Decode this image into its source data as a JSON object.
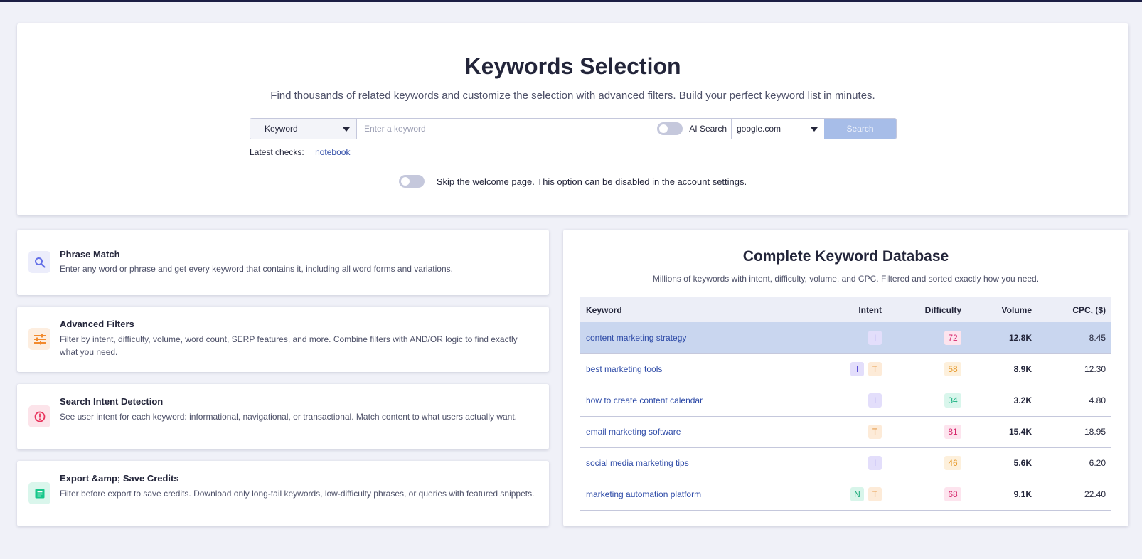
{
  "hero": {
    "title": "Keywords Selection",
    "subtitle": "Find thousands of related keywords and customize the selection with advanced filters. Build your perfect keyword list in minutes.",
    "search": {
      "mode_value": "Keyword",
      "placeholder": "Enter a keyword",
      "ai_label": "AI Search",
      "engine_value": "google.com",
      "button_label": "Search"
    },
    "latest_label": "Latest checks:",
    "latest_link": "notebook",
    "skip_text": "Skip the welcome page. This option can be disabled in the account settings."
  },
  "features": [
    {
      "title": "Phrase Match",
      "text": "Enter any word or phrase and get every keyword that contains it, including all word forms and variations.",
      "icon": "search-icon",
      "color": "#6470e8",
      "bg": "#ecedfb"
    },
    {
      "title": "Advanced Filters",
      "text": "Filter by intent, difficulty, volume, word count, SERP features, and more. Combine filters with AND/OR logic to find exactly what you need.",
      "icon": "sliders-icon",
      "color": "#f28a2e",
      "bg": "#fdeee0"
    },
    {
      "title": "Search Intent Detection",
      "text": "See user intent for each keyword: informational, navigational, or transactional. Match content to what users actually want.",
      "icon": "alert-circle-icon",
      "color": "#e8335c",
      "bg": "#fce4ea"
    },
    {
      "title": "Export &amp; Save Credits",
      "text": "Filter before export to save credits. Download only long-tail keywords, low-difficulty phrases, or queries with featured snippets.",
      "icon": "document-icon",
      "color": "#16c78a",
      "bg": "#daf6ec"
    }
  ],
  "database": {
    "title": "Complete Keyword Database",
    "subtitle": "Millions of keywords with intent, difficulty, volume, and CPC. Filtered and sorted exactly how you need.",
    "columns": [
      "Keyword",
      "Intent",
      "Difficulty",
      "Volume",
      "CPC, ($)"
    ],
    "rows": [
      {
        "keyword": "content marketing strategy",
        "intent": [
          "I"
        ],
        "difficulty": "72",
        "volume": "12.8K",
        "cpc": "8.45"
      },
      {
        "keyword": "best marketing tools",
        "intent": [
          "I",
          "T"
        ],
        "difficulty": "58",
        "volume": "8.9K",
        "cpc": "12.30"
      },
      {
        "keyword": "how to create content calendar",
        "intent": [
          "I"
        ],
        "difficulty": "34",
        "volume": "3.2K",
        "cpc": "4.80"
      },
      {
        "keyword": "email marketing software",
        "intent": [
          "T"
        ],
        "difficulty": "81",
        "volume": "15.4K",
        "cpc": "18.95"
      },
      {
        "keyword": "social media marketing tips",
        "intent": [
          "I"
        ],
        "difficulty": "46",
        "volume": "5.6K",
        "cpc": "6.20"
      },
      {
        "keyword": "marketing automation platform",
        "intent": [
          "N",
          "T"
        ],
        "difficulty": "68",
        "volume": "9.1K",
        "cpc": "22.40"
      }
    ]
  },
  "colors": {
    "intent": {
      "I": {
        "fg": "#5b4fd6",
        "bg": "#e3defb"
      },
      "T": {
        "fg": "#e08a2c",
        "bg": "#fdebd8"
      },
      "N": {
        "fg": "#17a878",
        "bg": "#d8f5ea"
      }
    },
    "difficulty_high": {
      "fg": "#d6246a",
      "bg": "#fde4ee"
    },
    "difficulty_medium": {
      "fg": "#e69a2d",
      "bg": "#fdf0dc"
    },
    "difficulty_low": {
      "fg": "#17b07f",
      "bg": "#d9f6ec"
    }
  }
}
